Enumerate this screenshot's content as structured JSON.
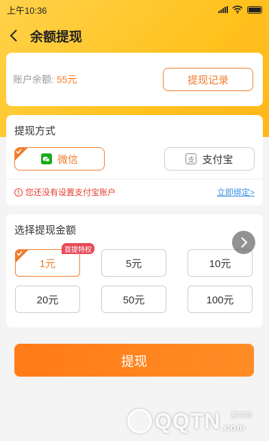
{
  "status_bar": {
    "time": "上午10:36"
  },
  "header": {
    "title": "余额提现"
  },
  "balance": {
    "label": "账户余额:",
    "value": "55元",
    "history_button": "提现记录"
  },
  "method": {
    "section_title": "提现方式",
    "options": [
      {
        "label": "微信",
        "icon": "wechat-icon",
        "selected": true
      },
      {
        "label": "支付宝",
        "icon": "alipay-icon",
        "selected": false
      }
    ],
    "notice": "您还没有设置支付宝账户",
    "bind_link": "立即绑定>"
  },
  "amount": {
    "section_title": "选择提现金额",
    "options": [
      {
        "label": "1元",
        "selected": true,
        "badge": "首提特权"
      },
      {
        "label": "5元",
        "selected": false
      },
      {
        "label": "10元",
        "selected": false
      },
      {
        "label": "20元",
        "selected": false
      },
      {
        "label": "50元",
        "selected": false
      },
      {
        "label": "100元",
        "selected": false
      }
    ]
  },
  "submit": {
    "label": "提现"
  },
  "watermark": {
    "text": "QQTN",
    "suffix": ".com",
    "small": "腾牛网"
  },
  "colors": {
    "accent": "#f07c2c",
    "header_yellow": "#ffc21f",
    "warning": "#e63a2e",
    "link": "#3a8ee6",
    "badge": "#e94a5a"
  }
}
